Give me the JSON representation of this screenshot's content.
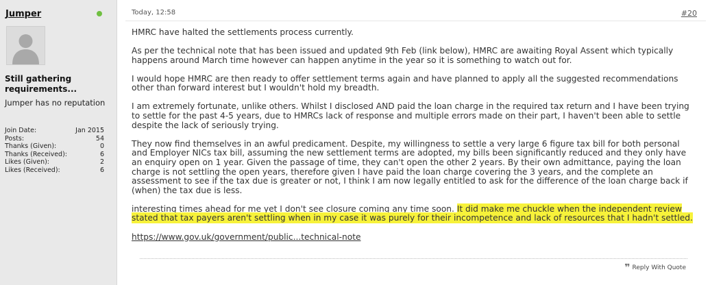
{
  "user": {
    "name": "Jumper",
    "title": "Still gathering requirements...",
    "reputation": "Jumper has no reputation",
    "stats": [
      {
        "label": "Join Date:",
        "value": "Jan 2015"
      },
      {
        "label": "Posts:",
        "value": "54"
      },
      {
        "label": "Thanks (Given):",
        "value": "0"
      },
      {
        "label": "Thanks (Received):",
        "value": "6"
      },
      {
        "label": "Likes (Given):",
        "value": "2"
      },
      {
        "label": "Likes (Received):",
        "value": "6"
      }
    ]
  },
  "post": {
    "date": "Today, 12:58",
    "number": "#20",
    "paragraphs": [
      "HMRC have halted the settlements process currently.",
      "As per the technical note that has been issued and updated 9th Feb (link below), HMRC are awaiting Royal Assent which typically happens around March time however can happen anytime in the year so it is something to watch out for.",
      "I would hope HMRC are then ready to offer settlement terms again and have planned to apply all the suggested recommendations other than forward interest but I wouldn't hold my breadth.",
      "I am extremely fortunate, unlike others. Whilst I disclosed AND paid the loan charge in the required tax return and I have been trying to settle for the past 4-5 years, due to HMRCs lack of response and multiple errors made on their part, I haven't been able to settle despite the lack of seriously trying.",
      "They now find themselves in an awful predicament. Despite, my willingness to settle a very large 6 figure tax bill for both personal and Employer NICs tax bill, assuming the new settlement terms are adopted, my bills been significantly reduced and they only have an enquiry open on 1 year. Given the passage of time, they can't open the other 2 years. By their own admittance, paying the loan charge is not settling the open years, therefore given I have paid the loan charge covering the 3 years, and the complete an assessment to see if the tax due is greater or not, I think I am now legally entitled to ask for the difference of the loan charge back if (when) the tax due is less."
    ],
    "last_paragraph_plain": "interesting times ahead for me yet I don't see closure coming any time soon. ",
    "last_paragraph_highlight": "It did make me chuckle when the independent review stated that tax payers aren't settling when in my case it was purely for their incompetence and lack of resources that I hadn't settled.",
    "link_text": "https://www.gov.uk/government/public...technical-note",
    "highlight_color": "#f7f23a"
  },
  "actions": {
    "reply_label": "Reply With Quote"
  },
  "icons": {
    "online": "online-status-icon",
    "avatar": "default-avatar-icon",
    "quote": "quote-icon"
  }
}
